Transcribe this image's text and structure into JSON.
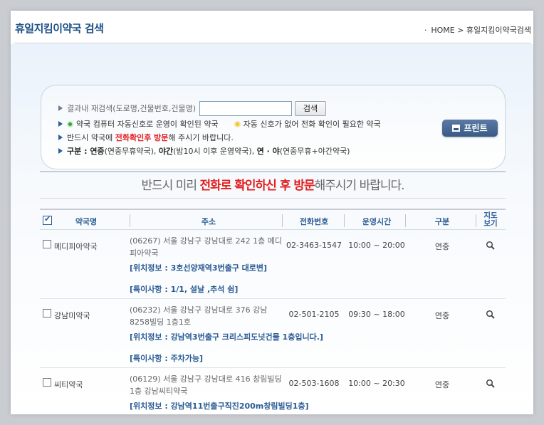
{
  "header": {
    "title": "휴일지킴이약국 검색",
    "breadcrumb_home": "HOME",
    "breadcrumb_sep": ">",
    "breadcrumb_current": "휴일지킴이약국검색"
  },
  "search": {
    "label": "결과내 재검색(도로명,건물번호,건물명)",
    "value": "",
    "button": "검색",
    "legend_green": "약국 컴퓨터 자동신호로 운영이 확인된 약국",
    "legend_yellow": "자동 신호가 없어 전화 확인이 필요한 약국",
    "notice_pre": "반드시 약국에 ",
    "notice_red": "전화확인후 방문",
    "notice_post": "해 주시기 바랍니다.",
    "kind_label": "구분 : ",
    "kind_yeonjung": "연중",
    "kind_yeonjung_desc": "(연중무휴약국), ",
    "kind_yagan": "야간",
    "kind_yagan_desc": "(밤10시 이후 운영약국), ",
    "kind_both": "연 · 야",
    "kind_both_desc": "(연중무휴+야간약국)",
    "print_button": "프린트"
  },
  "notice": {
    "pre": "반드시 미리 ",
    "highlight": "전화로 확인하신 후 방문",
    "post": "해주시기 바랍니다."
  },
  "table": {
    "headers": {
      "name": "약국명",
      "address": "주소",
      "phone": "전화번호",
      "hours": "운영시간",
      "kind": "구분",
      "map_line1": "지도",
      "map_line2": "보기"
    },
    "rows": [
      {
        "name": "메디피아약국",
        "address": "(06267) 서울 강남구 강남대로 242 1층 메디피아약국",
        "phone": "02-3463-1547",
        "hours": "10:00 ~ 20:00",
        "kind": "연중",
        "location": "[위치정보 : 3호선양재역3번출구 대로변]",
        "special": "[특이사항 : 1/1, 설날 ,추석 쉼]"
      },
      {
        "name": "강남미약국",
        "address": "(06232) 서울 강남구 강남대로 376 강남8258빌딩 1층1호",
        "phone": "02-501-2105",
        "hours": "09:30 ~ 18:00",
        "kind": "연중",
        "location": "[위치정보 : 강남역3번출구 크리스피도넛건물 1층입니다.]",
        "special": "[특이사항 : 주차가능]"
      },
      {
        "name": "씨티약국",
        "address": "(06129) 서울 강남구 강남대로 416 창림빌딩 1층 강남씨티약국",
        "phone": "02-503-1608",
        "hours": "10:00 ~ 20:30",
        "kind": "연중",
        "location": "[위치정보 : 강남역11번출구직진200m창림빌딩1층]",
        "special": ""
      }
    ]
  },
  "colors": {
    "title_blue": "#1c4f86",
    "header_blue": "#2a5b94",
    "red": "#e21f1f"
  }
}
